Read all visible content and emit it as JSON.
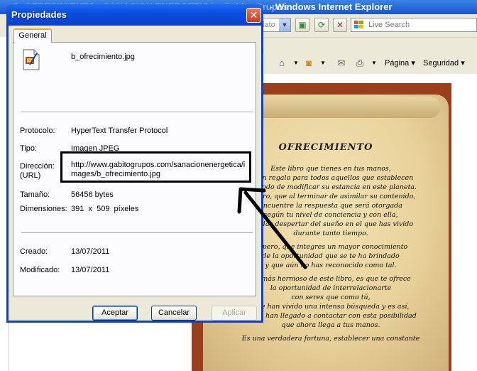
{
  "browser": {
    "title_left": "B. OFRECIMIENTO - SANACION ENERGETICA - Gabito Grupos",
    "title_right": "- Windows Internet Explorer",
    "dropdown_tail": "lato",
    "search_placeholder": "Live Search",
    "cmd": {
      "page_label": "Página",
      "safety_label": "Seguridad"
    },
    "icons": [
      "home-icon",
      "rss-feed-icon",
      "mail-icon",
      "print-icon",
      "refresh-icon",
      "stop-icon",
      "page-icon"
    ]
  },
  "page": {
    "poem_title": "OFRECIMIENTO",
    "poem_lines": [
      "Este libro que tienes en tus manos,",
      "es un regalo para todos aquellos que establecen",
      "un modo de modificar su estancia en este planeta.",
      "Espero, que al terminar de asimilar su contenido,",
      "encuentre la respuesta que será otorgada",
      "según tu nivel de conciencia y con ella,",
      "puedas despertar del sueño en el que has vivido",
      "durante tanto tiempo.",
      "",
      "Espero, que integres un mayor conocimiento",
      "de la oportunidad que se te ha brindado",
      "y que aún no has reconocido como tal.",
      "",
      "Lo más hermoso de este libro, es que te ofrece",
      "la oportunidad de interrelacionarte",
      "con seres que como tú,",
      "que han vivido una intensa búsqueda y es así,",
      "como han llegado a contactar con esta posibilidad",
      "que ahora llega a tus manos.",
      "",
      "Es una verdadera fortuna, establecer una constante"
    ]
  },
  "dialog": {
    "title": "Propiedades",
    "close_symbol": "✕",
    "tab_label": "General",
    "file_name": "b_ofrecimiento.jpg",
    "fields": {
      "protocol_label": "Protocolo:",
      "protocol_value": "HyperText Transfer Protocol",
      "type_label": "Tipo:",
      "type_value": "Imagen JPEG",
      "address_label_1": "Dirección:",
      "address_label_2": "(URL)",
      "address_line_1": "http://www.gabitogrupos.com/sanacionenergetica/i",
      "address_line_2": "mages/b_ofrecimiento.jpg",
      "size_label": "Tamaño:",
      "size_value": "56456 bytes",
      "dims_label": "Dimensiones:",
      "dims_value": "391  x  509  píxeles",
      "created_label": "Creado:",
      "created_value": "13/07/2011",
      "modified_label": "Modificado:",
      "modified_value": "13/07/2011"
    },
    "buttons": {
      "accept": "Aceptar",
      "cancel": "Cancelar",
      "apply": "Aplicar"
    }
  },
  "colors": {
    "dialog_titlebar": "#0a4ee0",
    "dialog_face": "#ece9d8",
    "close_button": "#c9391a",
    "page_frame": "#9a3e1b",
    "parchment": "#e9d29b"
  }
}
